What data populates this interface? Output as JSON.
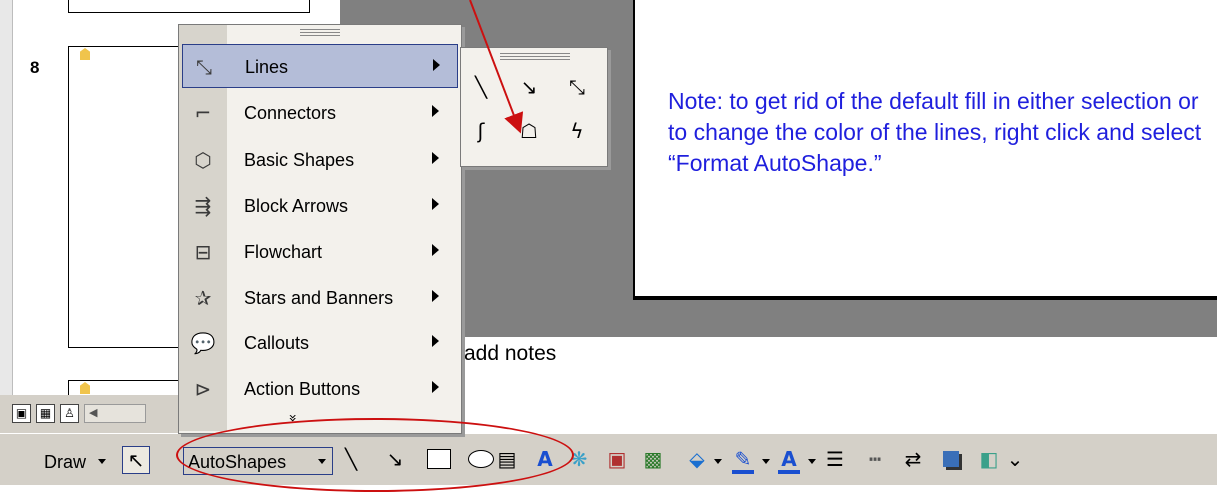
{
  "slide_pane": {
    "slide_number": "8"
  },
  "menu": {
    "items": [
      {
        "label": "Lines",
        "icon": "lines-icon"
      },
      {
        "label": "Connectors",
        "icon": "connectors-icon"
      },
      {
        "label": "Basic Shapes",
        "icon": "basic-shapes-icon"
      },
      {
        "label": "Block Arrows",
        "icon": "block-arrows-icon"
      },
      {
        "label": "Flowchart",
        "icon": "flowchart-icon"
      },
      {
        "label": "Stars and Banners",
        "icon": "stars-banners-icon"
      },
      {
        "label": "Callouts",
        "icon": "callouts-icon"
      },
      {
        "label": "Action Buttons",
        "icon": "action-buttons-icon"
      }
    ],
    "expand_glyph": "»"
  },
  "note": "Note: to get rid of the default fill in either selection or to change the color of the lines, right click and select “Format AutoShape.”",
  "notes_placeholder": "add notes",
  "toolbar": {
    "draw_label": "Draw",
    "autoshapes_label": "AutoShapes"
  },
  "colors": {
    "annotation_red": "#cc1010",
    "note_blue": "#1f1fdd",
    "menu_highlight": "#b4bdd8"
  }
}
